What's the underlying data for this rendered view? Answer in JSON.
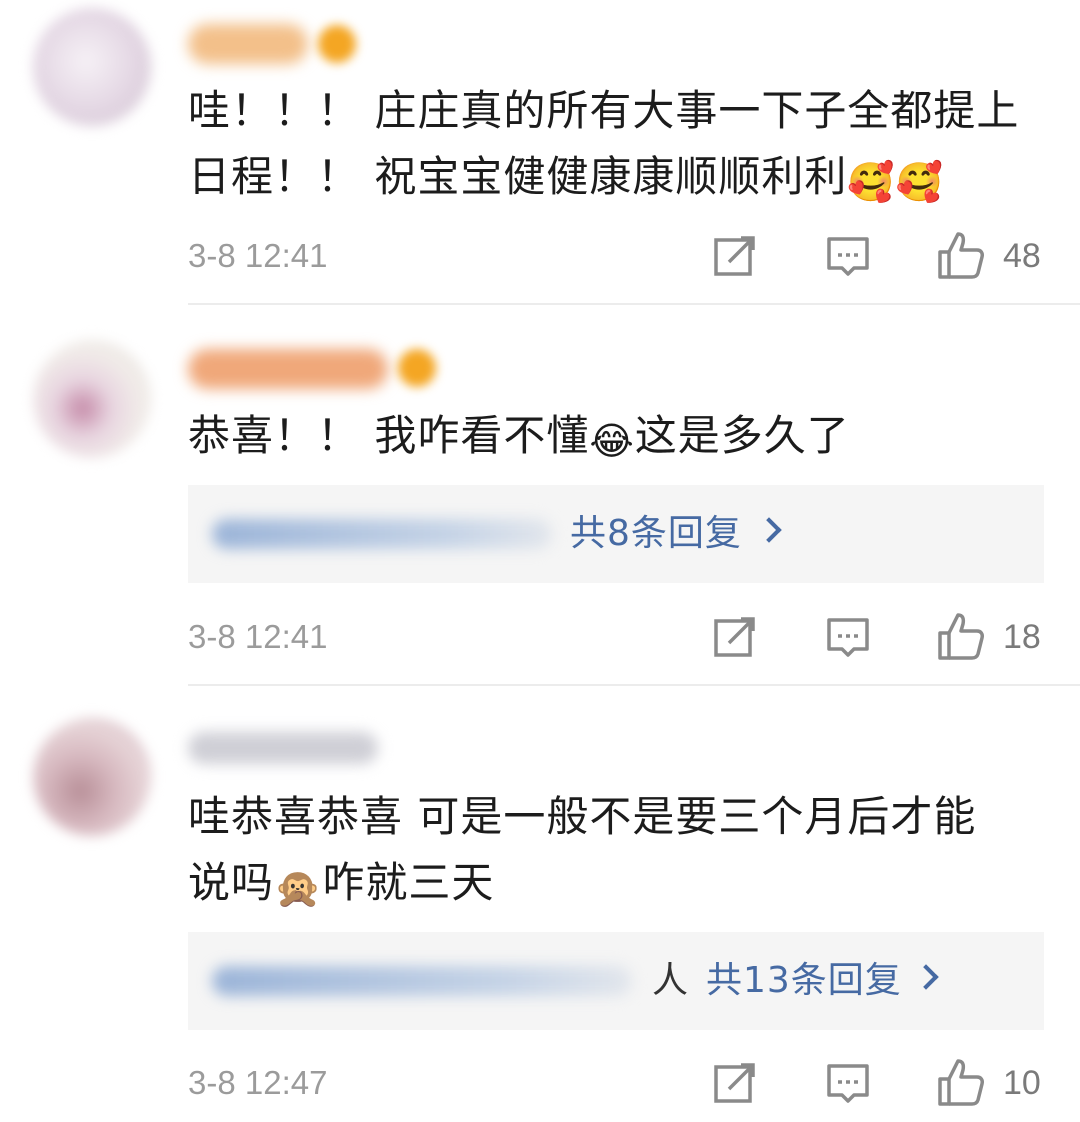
{
  "comments": [
    {
      "text_line1": "哇！！！ 庄庄真的所有大事一下子全都提上",
      "text_line2": "日程！！ 祝宝宝健健康康顺顺利利",
      "emojis": "🥰🥰",
      "time": "3-8 12:41",
      "likes": "48",
      "avatar_color": "#e9e1ea",
      "username_color": "#f3c08a"
    },
    {
      "text_before": "恭喜！！ 我咋看不懂",
      "emoji": "😂",
      "text_after": "这是多久了",
      "reply_count_text": "共8条回复",
      "time": "3-8 12:41",
      "likes": "18",
      "avatar_color": "#ecdfe6",
      "username_color": "#f0a87a"
    },
    {
      "text_line1": "哇恭喜恭喜 可是一般不是要三个月后才能",
      "text_before": "说吗",
      "emoji": "🙊",
      "text_after": "咋就三天",
      "reply_tail": "人",
      "reply_count_text": "共13条回复",
      "time": "3-8 12:47",
      "likes": "10",
      "avatar_color": "#d9bfc6",
      "username_color": "#cfcfd6"
    }
  ],
  "icons": {
    "share": "share-icon",
    "comment": "comment-icon",
    "like": "thumbs-up-icon"
  },
  "colors": {
    "link": "#466aa3",
    "meta": "#9b9b9b",
    "icon": "#8a8a8a",
    "reply_bg": "#f5f5f5"
  }
}
